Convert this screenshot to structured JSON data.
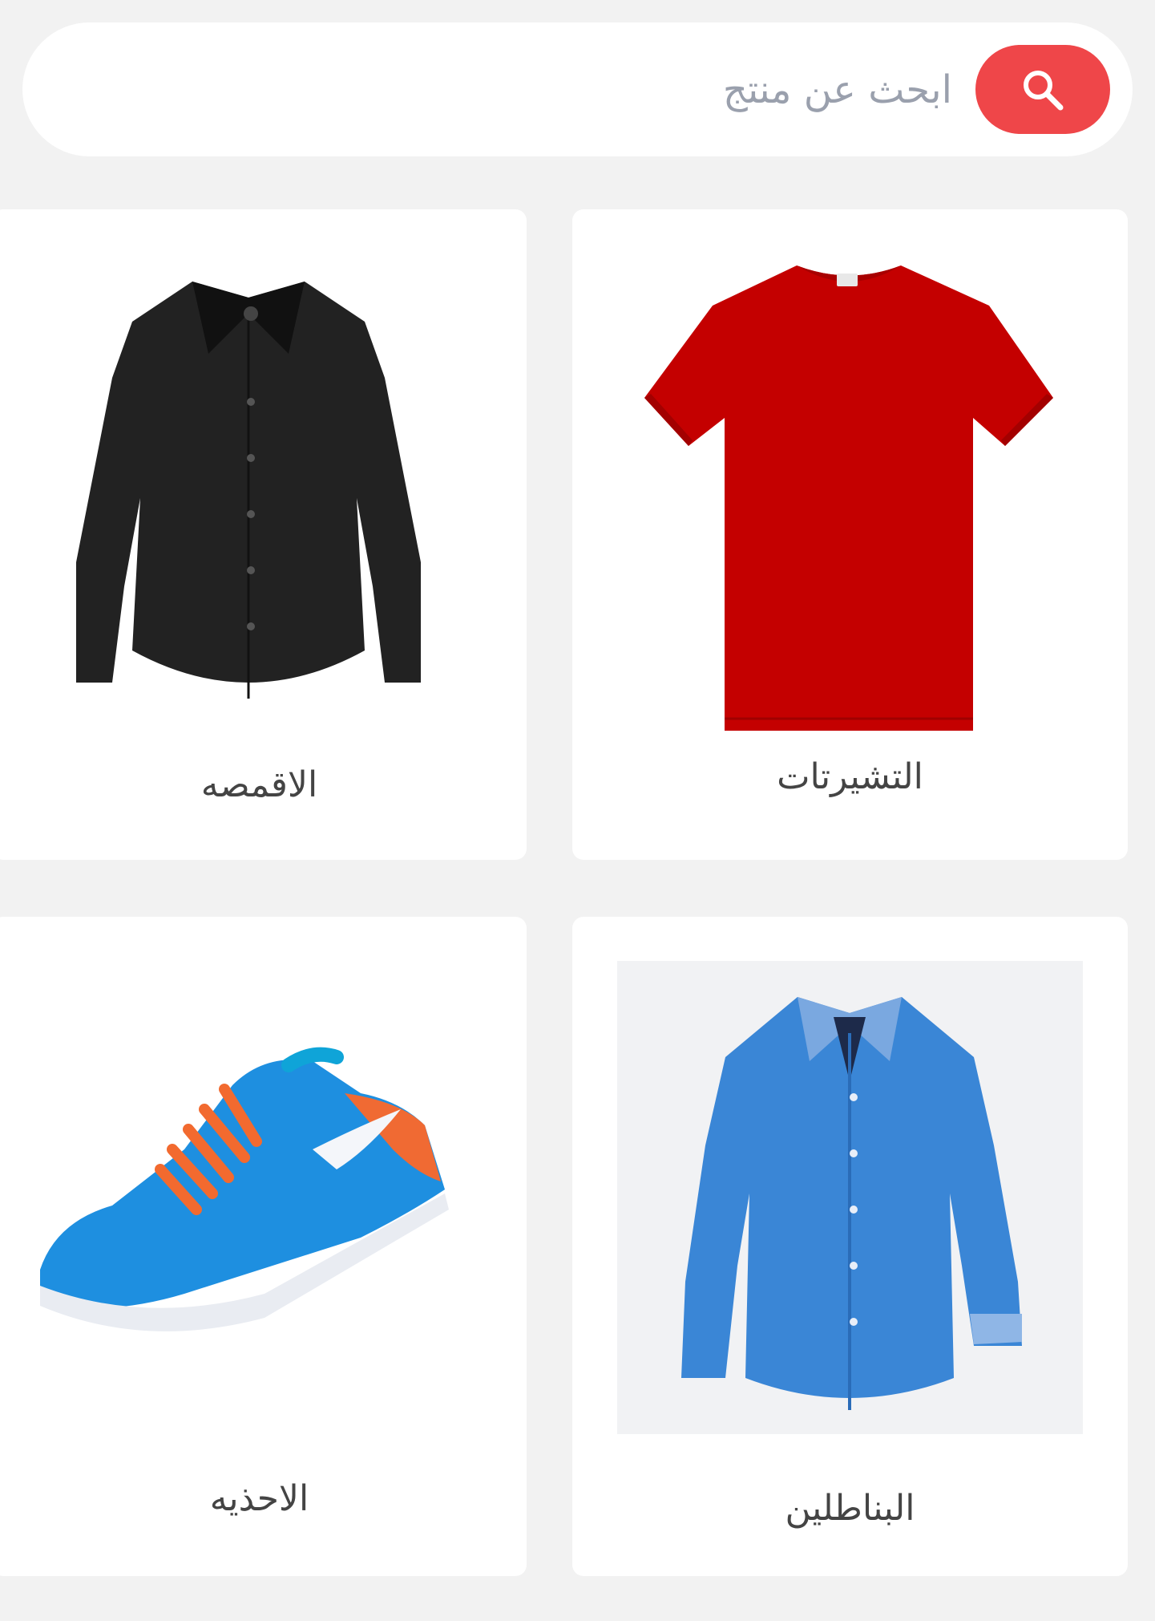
{
  "search": {
    "placeholder": "ابحث عن منتج",
    "value": "",
    "button_icon": "search-icon"
  },
  "categories": [
    {
      "label": "التشيرتات",
      "image": "red-tshirt"
    },
    {
      "label": "الاقمصه",
      "image": "black-shirt"
    },
    {
      "label": "البناطلين",
      "image": "blue-shirt"
    },
    {
      "label": "الاحذيه",
      "image": "blue-sneaker"
    }
  ],
  "colors": {
    "accent": "#ef4649",
    "background": "#f2f2f2",
    "card": "#ffffff",
    "placeholder": "#9aa0ad",
    "label": "#444444"
  }
}
